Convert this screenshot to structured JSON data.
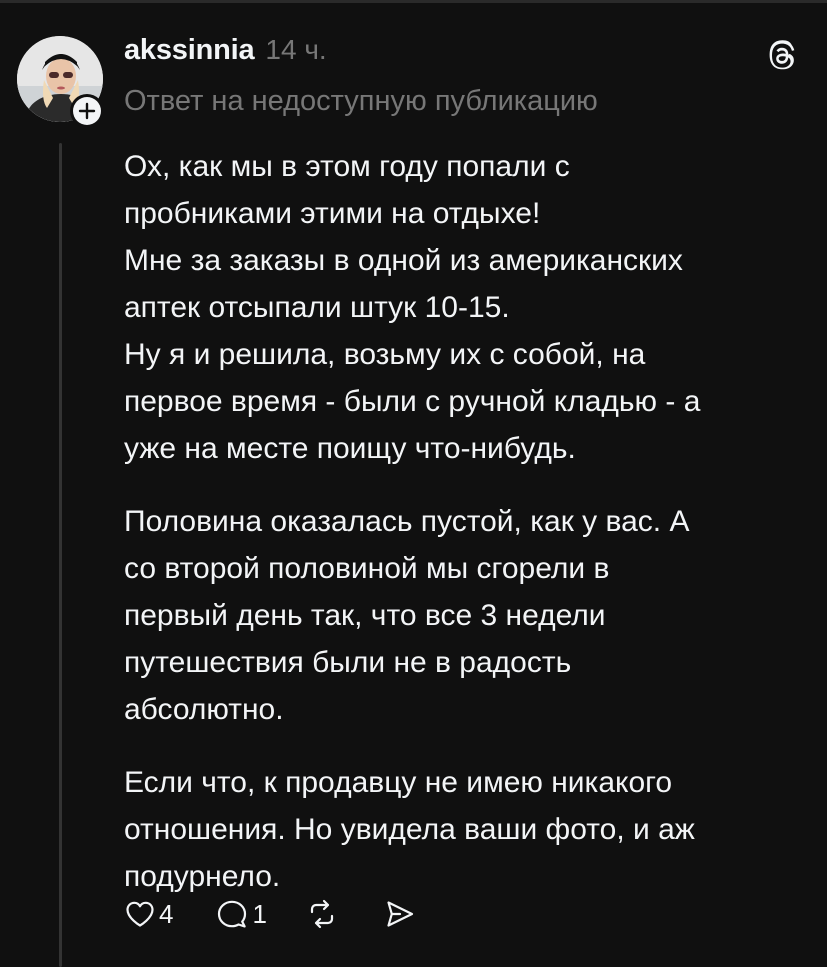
{
  "post": {
    "username": "akssinnia",
    "timestamp": "14 ч.",
    "reply_context": "Ответ на недоступную публикацию",
    "paragraphs": [
      {
        "lines": [
          "Ох, как мы в этом году попали с",
          "пробниками этими на отдыхе!",
          "Мне за заказы в одной из американских",
          "аптек отсыпали штук 10-15.",
          "Ну я и решила, возьму их с собой, на",
          "первое время - были с ручной кладью - а",
          "уже на месте поищу что-нибудь."
        ]
      },
      {
        "lines": [
          "Половина оказалась пустой, как у вас. А",
          "со второй половиной мы сгорели в",
          "первый день так, что все 3 недели",
          "путешествия были не в радость",
          "абсолютно."
        ]
      },
      {
        "lines": [
          "Если что, к продавцу не имею никакого",
          "отношения. Но увидела ваши фото, и аж",
          "подурнело."
        ]
      }
    ]
  },
  "actions": {
    "like_icon": "heart-icon",
    "like_count": "4",
    "comment_icon": "comment-bubble-icon",
    "comment_count": "1",
    "repost_icon": "repost-icon",
    "share_icon": "send-icon"
  },
  "header": {
    "logo_icon": "threads-logo-icon",
    "follow_icon": "plus-icon"
  },
  "colors": {
    "background": "#101010",
    "primary_text": "#f3f5f7",
    "secondary_text": "#777777",
    "thread_line": "#333333"
  }
}
